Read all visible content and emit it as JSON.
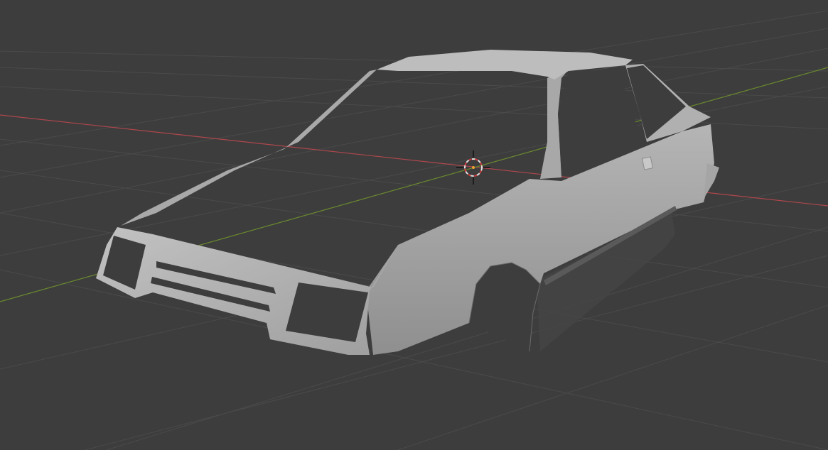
{
  "viewport": {
    "background": "#3d3d3d",
    "grid_color": "#4a4a4a",
    "x_axis_color": "#b0474d",
    "y_axis_color": "#6a8a2e"
  },
  "scene": {
    "object": "car-body-mesh",
    "body_color": "#b3b3b3",
    "cursor_icon": "3d-cursor-icon",
    "cursor_colors": [
      "#e0e0e0",
      "#d33a3a"
    ]
  }
}
